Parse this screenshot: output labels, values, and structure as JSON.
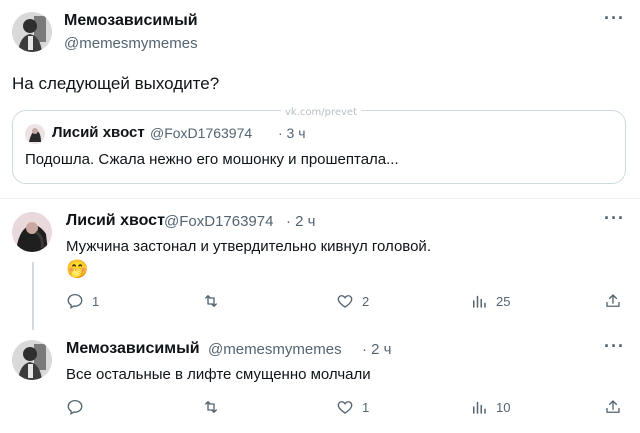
{
  "main_post": {
    "display_name": "Мемозависимый",
    "handle": "@memesmymemes",
    "text": "На следующей выходите?",
    "more": "···"
  },
  "quoted_post": {
    "display_name": "Лисий хвост",
    "handle": "@FoxD1763974",
    "time": "· 3 ч",
    "text": "Подошла. Сжала нежно его мошонку и прошептала...",
    "watermark": "vk.com/prevet"
  },
  "reply1": {
    "display_name": "Лисий хвост",
    "handle": "@FoxD1763974",
    "time": "· 2 ч",
    "text": "Мужчина застонал и утвердительно кивнул головой.",
    "emoji": "🤭",
    "more": "···",
    "actions": {
      "replies": "1",
      "retweets": "",
      "likes": "2",
      "views": "25"
    }
  },
  "reply2": {
    "display_name": "Мемозависимый",
    "handle": "@memesmymemes",
    "time": "· 2 ч",
    "text": "Все остальные в лифте смущенно молчали",
    "more": "···",
    "actions": {
      "replies": "",
      "retweets": "",
      "likes": "1",
      "views": "10"
    }
  },
  "icons": [
    "reply-icon",
    "retweet-icon",
    "like-icon",
    "views-icon",
    "share-icon",
    "more-icon"
  ]
}
